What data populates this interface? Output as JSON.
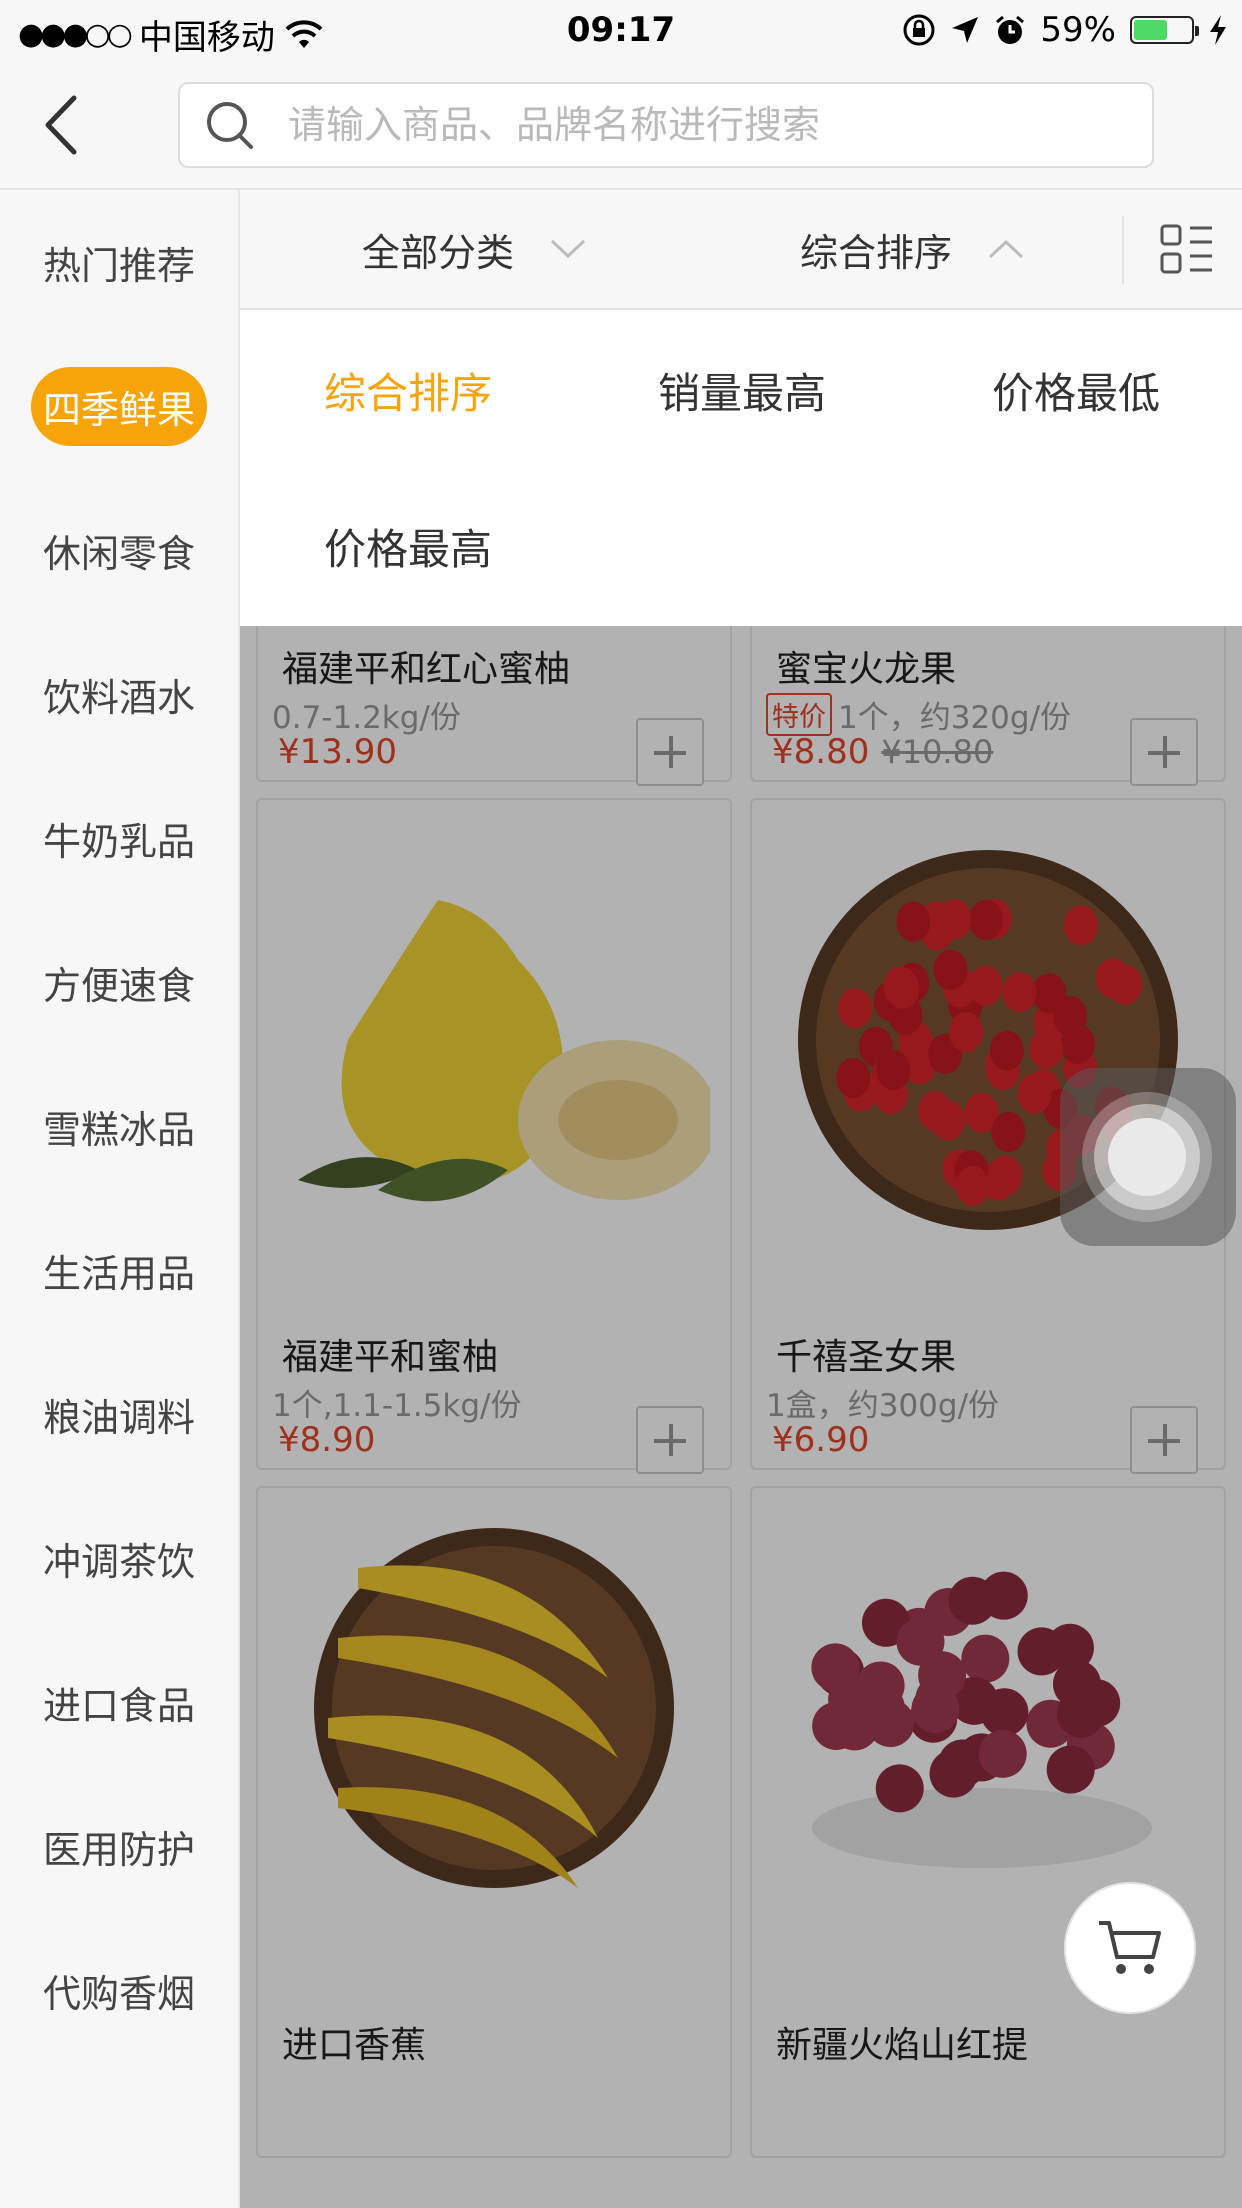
{
  "status_bar": {
    "signal": "●●●○○",
    "carrier": "中国移动",
    "time": "09:17",
    "battery": "59%",
    "battery_level": 0.59
  },
  "search": {
    "placeholder": "请输入商品、品牌名称进行搜索"
  },
  "sidebar": {
    "items": [
      {
        "label": "热门推荐"
      },
      {
        "label": "四季鲜果",
        "active": true
      },
      {
        "label": "休闲零食"
      },
      {
        "label": "饮料酒水"
      },
      {
        "label": "牛奶乳品"
      },
      {
        "label": "方便速食"
      },
      {
        "label": "雪糕冰品"
      },
      {
        "label": "生活用品"
      },
      {
        "label": "粮油调料"
      },
      {
        "label": "冲调茶饮"
      },
      {
        "label": "进口食品"
      },
      {
        "label": "医用防护"
      },
      {
        "label": "代购香烟"
      }
    ]
  },
  "filter": {
    "category_label": "全部分类",
    "sort_label": "综合排序"
  },
  "sort_options": [
    "综合排序",
    "销量最高",
    "价格最低",
    "价格最高"
  ],
  "products": [
    {
      "name": "福建平和红心蜜柚",
      "spec": "0.7-1.2kg/份",
      "price": "¥13.90"
    },
    {
      "name": "蜜宝火龙果",
      "tag": "特价",
      "spec": "1个，约320g/份",
      "price": "¥8.80",
      "old_price": "¥10.80"
    },
    {
      "name": "福建平和蜜柚",
      "spec": "1个,1.1-1.5kg/份",
      "price": "¥8.90"
    },
    {
      "name": "千禧圣女果",
      "spec": "1盒，约300g/份",
      "price": "¥6.90"
    },
    {
      "name": "进口香蕉"
    },
    {
      "name": "新疆火焰山红提"
    }
  ],
  "colors": {
    "accent": "#f7a40b",
    "price": "#e2462a"
  }
}
